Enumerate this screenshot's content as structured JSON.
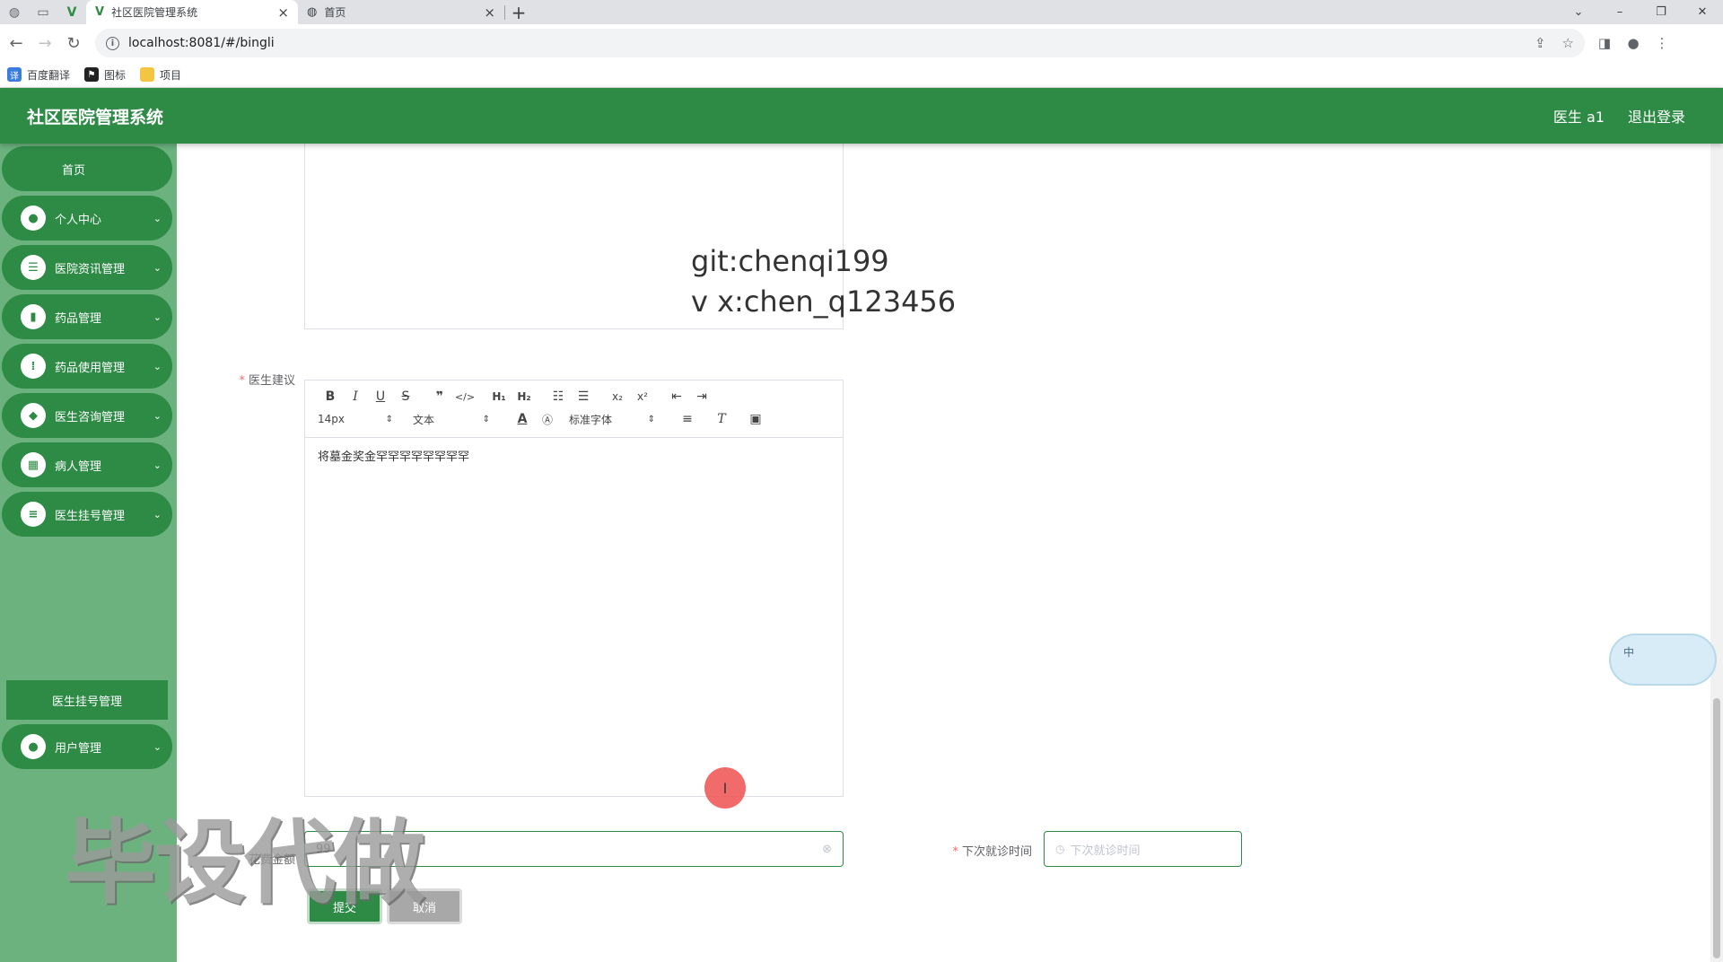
{
  "browser": {
    "tabs": [
      {
        "title": "社区医院管理系统",
        "active": true
      },
      {
        "title": "首页",
        "active": false
      }
    ],
    "url": "localhost:8081/#/bingli",
    "bookmarks": [
      "百度翻译",
      "图标",
      "项目"
    ]
  },
  "header": {
    "title": "社区医院管理系统",
    "user": "医生 a1",
    "logout": "退出登录"
  },
  "sidebar": {
    "items": [
      {
        "label": "首页",
        "icon": "home"
      },
      {
        "label": "个人中心",
        "icon": "user-icon"
      },
      {
        "label": "医院资讯管理",
        "icon": "sliders-icon"
      },
      {
        "label": "药品管理",
        "icon": "bar-chart-icon"
      },
      {
        "label": "药品使用管理",
        "icon": "grid-icon"
      },
      {
        "label": "医生咨询管理",
        "icon": "chat-icon"
      },
      {
        "label": "病人管理",
        "icon": "apps-icon"
      },
      {
        "label": "医生挂号管理",
        "icon": "list-icon"
      },
      {
        "label": "用户管理",
        "icon": "person-icon"
      }
    ],
    "submenu": "医生挂号管理"
  },
  "watermark": {
    "line1": "git:chenqi199",
    "line2": "v x:chen_q123456",
    "overlay": "毕设代做"
  },
  "form": {
    "advice_label": "医生建议",
    "editor": {
      "font_size": "14px",
      "format": "文本",
      "font_family": "标准字体",
      "content": "将墓金奖金罕罕罕罕罕罕罕罕"
    },
    "amount_label": "花费金额",
    "amount_value": "99",
    "next_visit_label": "下次就诊时间",
    "next_visit_placeholder": "下次就诊时间",
    "submit": "提交",
    "cancel": "取消"
  },
  "float_widget": {
    "text": "中"
  },
  "colors": {
    "primary": "#2e8b46",
    "sidebar": "#6cb27f"
  }
}
